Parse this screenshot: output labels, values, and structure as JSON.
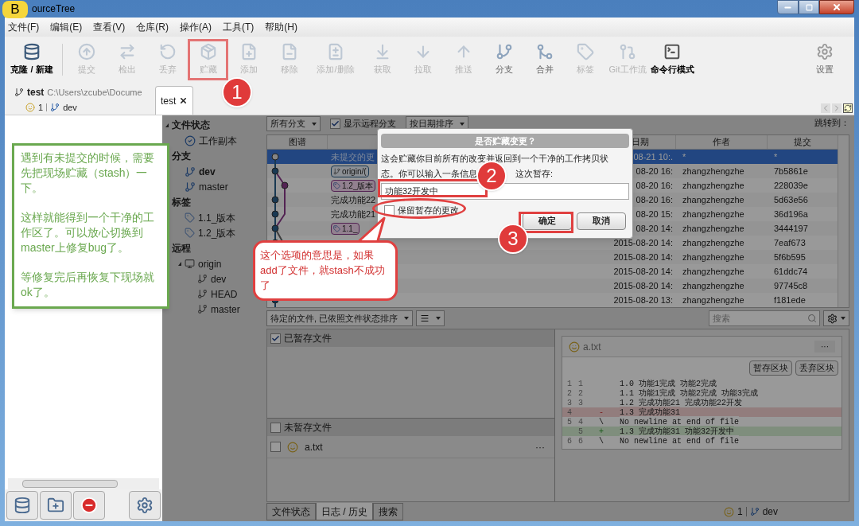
{
  "window": {
    "title": "ourceTree",
    "badge": "B"
  },
  "menu": [
    "文件(F)",
    "编辑(E)",
    "查看(V)",
    "仓库(R)",
    "操作(A)",
    "工具(T)",
    "帮助(H)"
  ],
  "toolbar": [
    {
      "label": "克隆 / 新建",
      "disabled": false
    },
    {
      "label": "提交",
      "disabled": true
    },
    {
      "label": "检出",
      "disabled": true
    },
    {
      "label": "丢弃",
      "disabled": true
    },
    {
      "label": "贮藏",
      "disabled": true,
      "highlighted": true
    },
    {
      "label": "添加",
      "disabled": true
    },
    {
      "label": "移除",
      "disabled": true
    },
    {
      "label": "添加/删除",
      "disabled": true
    },
    {
      "label": "获取",
      "disabled": true
    },
    {
      "label": "拉取",
      "disabled": true
    },
    {
      "label": "推送",
      "disabled": true
    },
    {
      "label": "分支",
      "disabled": false
    },
    {
      "label": "合并",
      "disabled": false
    },
    {
      "label": "标签",
      "disabled": true
    },
    {
      "label": "Git工作流",
      "disabled": true
    },
    {
      "label": "命令行模式",
      "disabled": false
    }
  ],
  "settings": {
    "label": "设置"
  },
  "repo": {
    "name": "test",
    "path": "C:\\Users\\zcube\\Docume",
    "changes": "1",
    "branch": "dev"
  },
  "tabs": [
    {
      "label": "test",
      "selected": true
    }
  ],
  "note": {
    "paragraphs": [
      "遇到有未提交的时候，需要先把现场贮藏（stash）一下。",
      "这样就能得到一个干净的工作区了。可以放心切换到master上修复bug了。",
      "等修复完后再恢复下现场就ok了。"
    ]
  },
  "sidebar": [
    {
      "label": "文件状态",
      "expanded": true,
      "children": [
        {
          "label": "工作副本",
          "kind": "working-copy"
        }
      ]
    },
    {
      "label": "分支",
      "children": [
        {
          "label": "dev",
          "kind": "branch",
          "current": true
        },
        {
          "label": "master",
          "kind": "branch",
          "current": false
        }
      ]
    },
    {
      "label": "标签",
      "children": [
        {
          "label": "1.1_版本",
          "kind": "tag"
        },
        {
          "label": "1.2_版本",
          "kind": "tag"
        }
      ]
    },
    {
      "label": "远程",
      "children": [
        {
          "label": "origin",
          "kind": "remote",
          "expanded": true,
          "children": [
            {
              "label": "dev",
              "kind": "remote-branch"
            },
            {
              "label": "HEAD",
              "kind": "remote-branch"
            },
            {
              "label": "master",
              "kind": "remote-branch"
            }
          ]
        }
      ]
    }
  ],
  "log": {
    "branch_filter": "所有分支",
    "show_remote": {
      "label": "显示远程分支",
      "checked": true
    },
    "sort": "按日期排序",
    "jump": "跳转到：",
    "columns": [
      "图谱",
      "日期",
      "作者",
      "提交"
    ],
    "rows": [
      {
        "description": "未提交的更",
        "kind": "text",
        "date": "08-21 10:.",
        "author": "*",
        "commit": "*",
        "selected": true
      },
      {
        "description": "origin/(",
        "kind": "branch",
        "date": "08-20 16:",
        "author": "zhangzhengzhe",
        "commit": "7b5861e",
        "selected": false
      },
      {
        "description": "1.2_版本",
        "kind": "tag",
        "date": "08-20 16:",
        "author": "zhangzhengzhe",
        "commit": "228039e",
        "selected": false
      },
      {
        "description": "完成功能22",
        "kind": "text",
        "date": "08-20 16:",
        "author": "zhangzhengzhe",
        "commit": "5d63e56",
        "selected": false
      },
      {
        "description": "完成功能21",
        "kind": "text",
        "date": "08-20 15:",
        "author": "zhangzhengzhe",
        "commit": "36d196a",
        "selected": false
      },
      {
        "description": "1.1_",
        "kind": "tag",
        "date": "08-20 14:",
        "author": "zhangzhengzhe",
        "commit": "3444197",
        "selected": false
      },
      {
        "date": "2015-08-20 14:",
        "author": "zhangzhengzhe",
        "commit": "7eaf673",
        "selected": false
      },
      {
        "date": "2015-08-20 14:",
        "author": "zhangzhengzhe",
        "commit": "5f6b595",
        "selected": false
      },
      {
        "date": "2015-08-20 14:",
        "author": "zhangzhengzhe",
        "commit": "61ddc74",
        "selected": false
      },
      {
        "date": "2015-08-20 14:",
        "author": "zhangzhengzhe",
        "commit": "97745c8",
        "selected": false
      },
      {
        "date": "2015-08-20 13:",
        "author": "zhangzhengzhe",
        "commit": "f181ede",
        "selected": false
      }
    ]
  },
  "dialog": {
    "title": "是否贮藏变更？",
    "message_line": "这会贮藏你目前所有的改变并返回到一个干净的工作拷贝状",
    "message_start": "态。你可以输入一条信息",
    "message_end": "这次暂存:",
    "value": "功能32开发中",
    "keep": {
      "label": "保留暂存的更改",
      "checked": false
    },
    "ok": "确定",
    "cancel": "取消"
  },
  "callout": "这个选项的意思是，如果add了文件，就stash不成功了",
  "steps": [
    "1",
    "2",
    "3"
  ],
  "pending": {
    "sort": "待定的文件, 已依照文件状态排序",
    "search_placeholder": "搜索",
    "staged": {
      "label": "已暂存文件",
      "checked": true
    },
    "unstaged": {
      "label": "未暂存文件",
      "checked": false
    },
    "files": [
      {
        "name": "a.txt",
        "checked": false,
        "more": "···"
      }
    ]
  },
  "diff": {
    "file": "a.txt",
    "more": "···",
    "buttons": [
      "暂存区块",
      "丢弃区块"
    ],
    "lines": [
      {
        "old": "1",
        "new": "1",
        "kind": "context",
        "text": "1.0 功能1完成 功能2完成"
      },
      {
        "old": "2",
        "new": "2",
        "kind": "context",
        "text": "1.1 功能1完成 功能2完成 功能3完成"
      },
      {
        "old": "3",
        "new": "3",
        "kind": "context",
        "text": "1.2 完成功能21 完成功能22开发"
      },
      {
        "old": "4",
        "kind": "removed",
        "sign": "-",
        "text": "1.3 完成功能31"
      },
      {
        "old": "5",
        "new": "4",
        "kind": "context",
        "sign": "\\",
        "text": "No newline at end of file"
      },
      {
        "new": "5",
        "kind": "added",
        "sign": "+",
        "text": "1.3 完成功能31 功能32开发中"
      },
      {
        "old": "6",
        "new": "6",
        "kind": "context",
        "sign": "\\",
        "text": "No newline at end of file"
      }
    ]
  },
  "bottom_tabs": [
    {
      "label": "文件状态",
      "selected": false
    },
    {
      "label": "日志 / 历史",
      "selected": true
    },
    {
      "label": "搜索",
      "selected": false
    }
  ],
  "status": {
    "changes": "1",
    "branch": "dev"
  }
}
